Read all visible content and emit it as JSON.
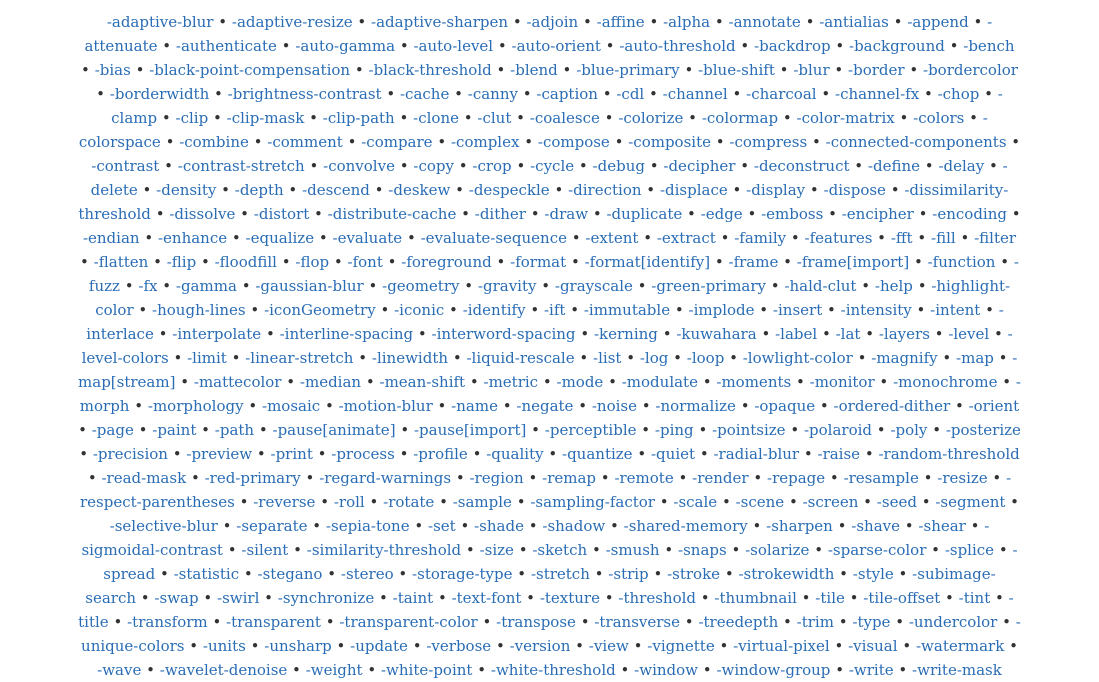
{
  "separator": "•",
  "options": [
    "-adaptive-blur",
    "-adaptive-resize",
    "-adaptive-sharpen",
    "-adjoin",
    "-affine",
    "-alpha",
    "-annotate",
    "-antialias",
    "-append",
    "-attenuate",
    "-authenticate",
    "-auto-gamma",
    "-auto-level",
    "-auto-orient",
    "-auto-threshold",
    "-backdrop",
    "-background",
    "-bench",
    "-bias",
    "-black-point-compensation",
    "-black-threshold",
    "-blend",
    "-blue-primary",
    "-blue-shift",
    "-blur",
    "-border",
    "-bordercolor",
    "-borderwidth",
    "-brightness-contrast",
    "-cache",
    "-canny",
    "-caption",
    "-cdl",
    "-channel",
    "-charcoal",
    "-channel-fx",
    "-chop",
    "-clamp",
    "-clip",
    "-clip-mask",
    "-clip-path",
    "-clone",
    "-clut",
    "-coalesce",
    "-colorize",
    "-colormap",
    "-color-matrix",
    "-colors",
    "-colorspace",
    "-combine",
    "-comment",
    "-compare",
    "-complex",
    "-compose",
    "-composite",
    "-compress",
    "-connected-components",
    "-contrast",
    "-contrast-stretch",
    "-convolve",
    "-copy",
    "-crop",
    "-cycle",
    "-debug",
    "-decipher",
    "-deconstruct",
    "-define",
    "-delay",
    "-delete",
    "-density",
    "-depth",
    "-descend",
    "-deskew",
    "-despeckle",
    "-direction",
    "-displace",
    "-display",
    "-dispose",
    "-dissimilarity-threshold",
    "-dissolve",
    "-distort",
    "-distribute-cache",
    "-dither",
    "-draw",
    "-duplicate",
    "-edge",
    "-emboss",
    "-encipher",
    "-encoding",
    "-endian",
    "-enhance",
    "-equalize",
    "-evaluate",
    "-evaluate-sequence",
    "-extent",
    "-extract",
    "-family",
    "-features",
    "-fft",
    "-fill",
    "-filter",
    "-flatten",
    "-flip",
    "-floodfill",
    "-flop",
    "-font",
    "-foreground",
    "-format",
    "-format[identify]",
    "-frame",
    "-frame[import]",
    "-function",
    "-fuzz",
    "-fx",
    "-gamma",
    "-gaussian-blur",
    "-geometry",
    "-gravity",
    "-grayscale",
    "-green-primary",
    "-hald-clut",
    "-help",
    "-highlight-color",
    "-hough-lines",
    "-iconGeometry",
    "-iconic",
    "-identify",
    "-ift",
    "-immutable",
    "-implode",
    "-insert",
    "-intensity",
    "-intent",
    "-interlace",
    "-interpolate",
    "-interline-spacing",
    "-interword-spacing",
    "-kerning",
    "-kuwahara",
    "-label",
    "-lat",
    "-layers",
    "-level",
    "-level-colors",
    "-limit",
    "-linear-stretch",
    "-linewidth",
    "-liquid-rescale",
    "-list",
    "-log",
    "-loop",
    "-lowlight-color",
    "-magnify",
    "-map",
    "-map[stream]",
    "-mattecolor",
    "-median",
    "-mean-shift",
    "-metric",
    "-mode",
    "-modulate",
    "-moments",
    "-monitor",
    "-monochrome",
    "-morph",
    "-morphology",
    "-mosaic",
    "-motion-blur",
    "-name",
    "-negate",
    "-noise",
    "-normalize",
    "-opaque",
    "-ordered-dither",
    "-orient",
    "-page",
    "-paint",
    "-path",
    "-pause[animate]",
    "-pause[import]",
    "-perceptible",
    "-ping",
    "-pointsize",
    "-polaroid",
    "-poly",
    "-posterize",
    "-precision",
    "-preview",
    "-print",
    "-process",
    "-profile",
    "-quality",
    "-quantize",
    "-quiet",
    "-radial-blur",
    "-raise",
    "-random-threshold",
    "-read-mask",
    "-red-primary",
    "-regard-warnings",
    "-region",
    "-remap",
    "-remote",
    "-render",
    "-repage",
    "-resample",
    "-resize",
    "-respect-parentheses",
    "-reverse",
    "-roll",
    "-rotate",
    "-sample",
    "-sampling-factor",
    "-scale",
    "-scene",
    "-screen",
    "-seed",
    "-segment",
    "-selective-blur",
    "-separate",
    "-sepia-tone",
    "-set",
    "-shade",
    "-shadow",
    "-shared-memory",
    "-sharpen",
    "-shave",
    "-shear",
    "-sigmoidal-contrast",
    "-silent",
    "-similarity-threshold",
    "-size",
    "-sketch",
    "-smush",
    "-snaps",
    "-solarize",
    "-sparse-color",
    "-splice",
    "-spread",
    "-statistic",
    "-stegano",
    "-stereo",
    "-storage-type",
    "-stretch",
    "-strip",
    "-stroke",
    "-strokewidth",
    "-style",
    "-subimage-search",
    "-swap",
    "-swirl",
    "-synchronize",
    "-taint",
    "-text-font",
    "-texture",
    "-threshold",
    "-thumbnail",
    "-tile",
    "-tile-offset",
    "-tint",
    "-title",
    "-transform",
    "-transparent",
    "-transparent-color",
    "-transpose",
    "-transverse",
    "-treedepth",
    "-trim",
    "-type",
    "-undercolor",
    "-unique-colors",
    "-units",
    "-unsharp",
    "-update",
    "-verbose",
    "-version",
    "-view",
    "-vignette",
    "-virtual-pixel",
    "-visual",
    "-watermark",
    "-wave",
    "-wavelet-denoise",
    "-weight",
    "-white-point",
    "-white-threshold",
    "-window",
    "-window-group",
    "-write",
    "-write-mask"
  ]
}
